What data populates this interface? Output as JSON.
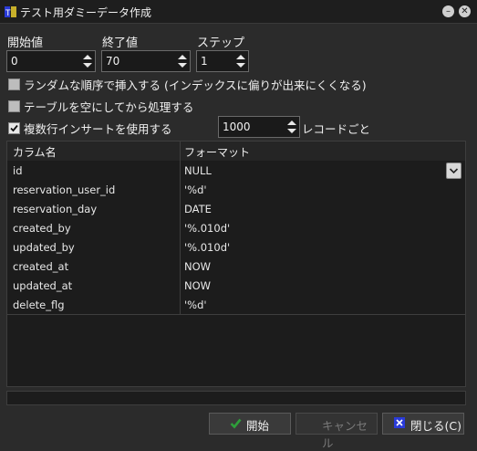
{
  "window": {
    "title": "テスト用ダミーデータ作成",
    "min_glyph": "–",
    "close_glyph": "✕"
  },
  "fields": {
    "start": {
      "label": "開始値",
      "value": "0"
    },
    "end": {
      "label": "終了値",
      "value": "70"
    },
    "step": {
      "label": "ステップ",
      "value": "1"
    }
  },
  "options": {
    "random": {
      "label": "ランダムな順序で挿入する (インデックスに偏りが出来にくくなる)",
      "checked": false
    },
    "truncate": {
      "label": "テーブルを空にしてから処理する",
      "checked": false
    },
    "multirow": {
      "label": "複数行インサートを使用する",
      "checked": true,
      "value": "1000",
      "suffix": "レコードごと"
    }
  },
  "grid": {
    "headers": [
      "カラム名",
      "フォーマット"
    ],
    "rows": [
      [
        "id",
        "NULL"
      ],
      [
        "reservation_user_id",
        "'%d'"
      ],
      [
        "reservation_day",
        "DATE"
      ],
      [
        "created_by",
        "'%.010d'"
      ],
      [
        "updated_by",
        "'%.010d'"
      ],
      [
        "created_at",
        "NOW"
      ],
      [
        "updated_at",
        "NOW"
      ],
      [
        "delete_flg",
        "'%d'"
      ]
    ]
  },
  "buttons": {
    "start": "開始",
    "cancel": "キャンセル",
    "close": "閉じる(C)"
  },
  "progress": {
    "value": 0
  },
  "colors": {
    "check_green": "#2e9e3a",
    "close_blue": "#2a3bd8"
  }
}
